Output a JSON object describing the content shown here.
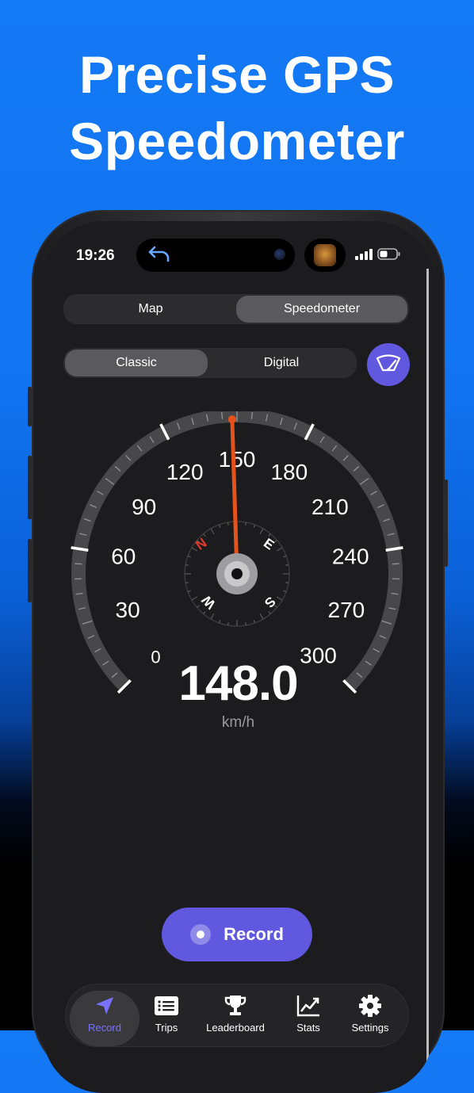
{
  "headline": {
    "line1": "Precise GPS",
    "line2": "Speedometer"
  },
  "status_bar": {
    "time": "19:26"
  },
  "view_switch": {
    "options": [
      "Map",
      "Speedometer"
    ],
    "selected": "Speedometer"
  },
  "style_switch": {
    "options": [
      "Classic",
      "Digital"
    ],
    "selected": "Classic"
  },
  "speedometer": {
    "scale_labels": [
      "0",
      "30",
      "60",
      "90",
      "120",
      "150",
      "180",
      "210",
      "240",
      "270",
      "300"
    ],
    "compass": {
      "north": "N",
      "east": "E",
      "south": "S",
      "west": "W"
    },
    "speed": "148.0",
    "speed_numeric": 148.0,
    "max": 300,
    "unit": "km/h",
    "needle_color": "#e5531a"
  },
  "record_button": {
    "label": "Record"
  },
  "tabbar": {
    "items": [
      {
        "label": "Record",
        "icon": "location-arrow-icon",
        "active": true
      },
      {
        "label": "Trips",
        "icon": "list-icon",
        "active": false
      },
      {
        "label": "Leaderboard",
        "icon": "trophy-icon",
        "active": false
      },
      {
        "label": "Stats",
        "icon": "chart-icon",
        "active": false
      },
      {
        "label": "Settings",
        "icon": "gear-icon",
        "active": false
      }
    ]
  },
  "colors": {
    "accent": "#6059e0",
    "background_top": "#1479f5",
    "screen": "#1c1c1e"
  }
}
